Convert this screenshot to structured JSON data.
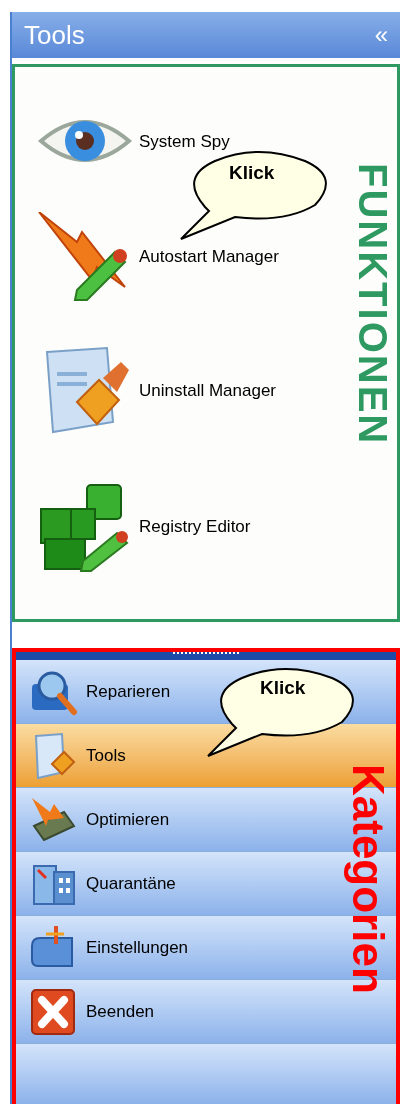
{
  "panel": {
    "title": "Tools",
    "collapse_glyph": "«"
  },
  "functions": {
    "label": "FUNKTIONEN",
    "callout": "Klick",
    "items": [
      {
        "label": "System Spy",
        "kind": "eye"
      },
      {
        "label": "Autostart Manager",
        "kind": "bolt"
      },
      {
        "label": "Uninstall Manager",
        "kind": "brush"
      },
      {
        "label": "Registry Editor",
        "kind": "cubes"
      }
    ]
  },
  "categories": {
    "label": "Kategorien",
    "callout": "Klick",
    "items": [
      {
        "label": "Reparieren",
        "kind": "repair",
        "selected": false
      },
      {
        "label": "Tools",
        "kind": "tools",
        "selected": true
      },
      {
        "label": "Optimieren",
        "kind": "chip",
        "selected": false
      },
      {
        "label": "Quarantäne",
        "kind": "building",
        "selected": false
      },
      {
        "label": "Einstellungen",
        "kind": "toolbox",
        "selected": false
      },
      {
        "label": "Beenden",
        "kind": "exit",
        "selected": false
      }
    ]
  }
}
